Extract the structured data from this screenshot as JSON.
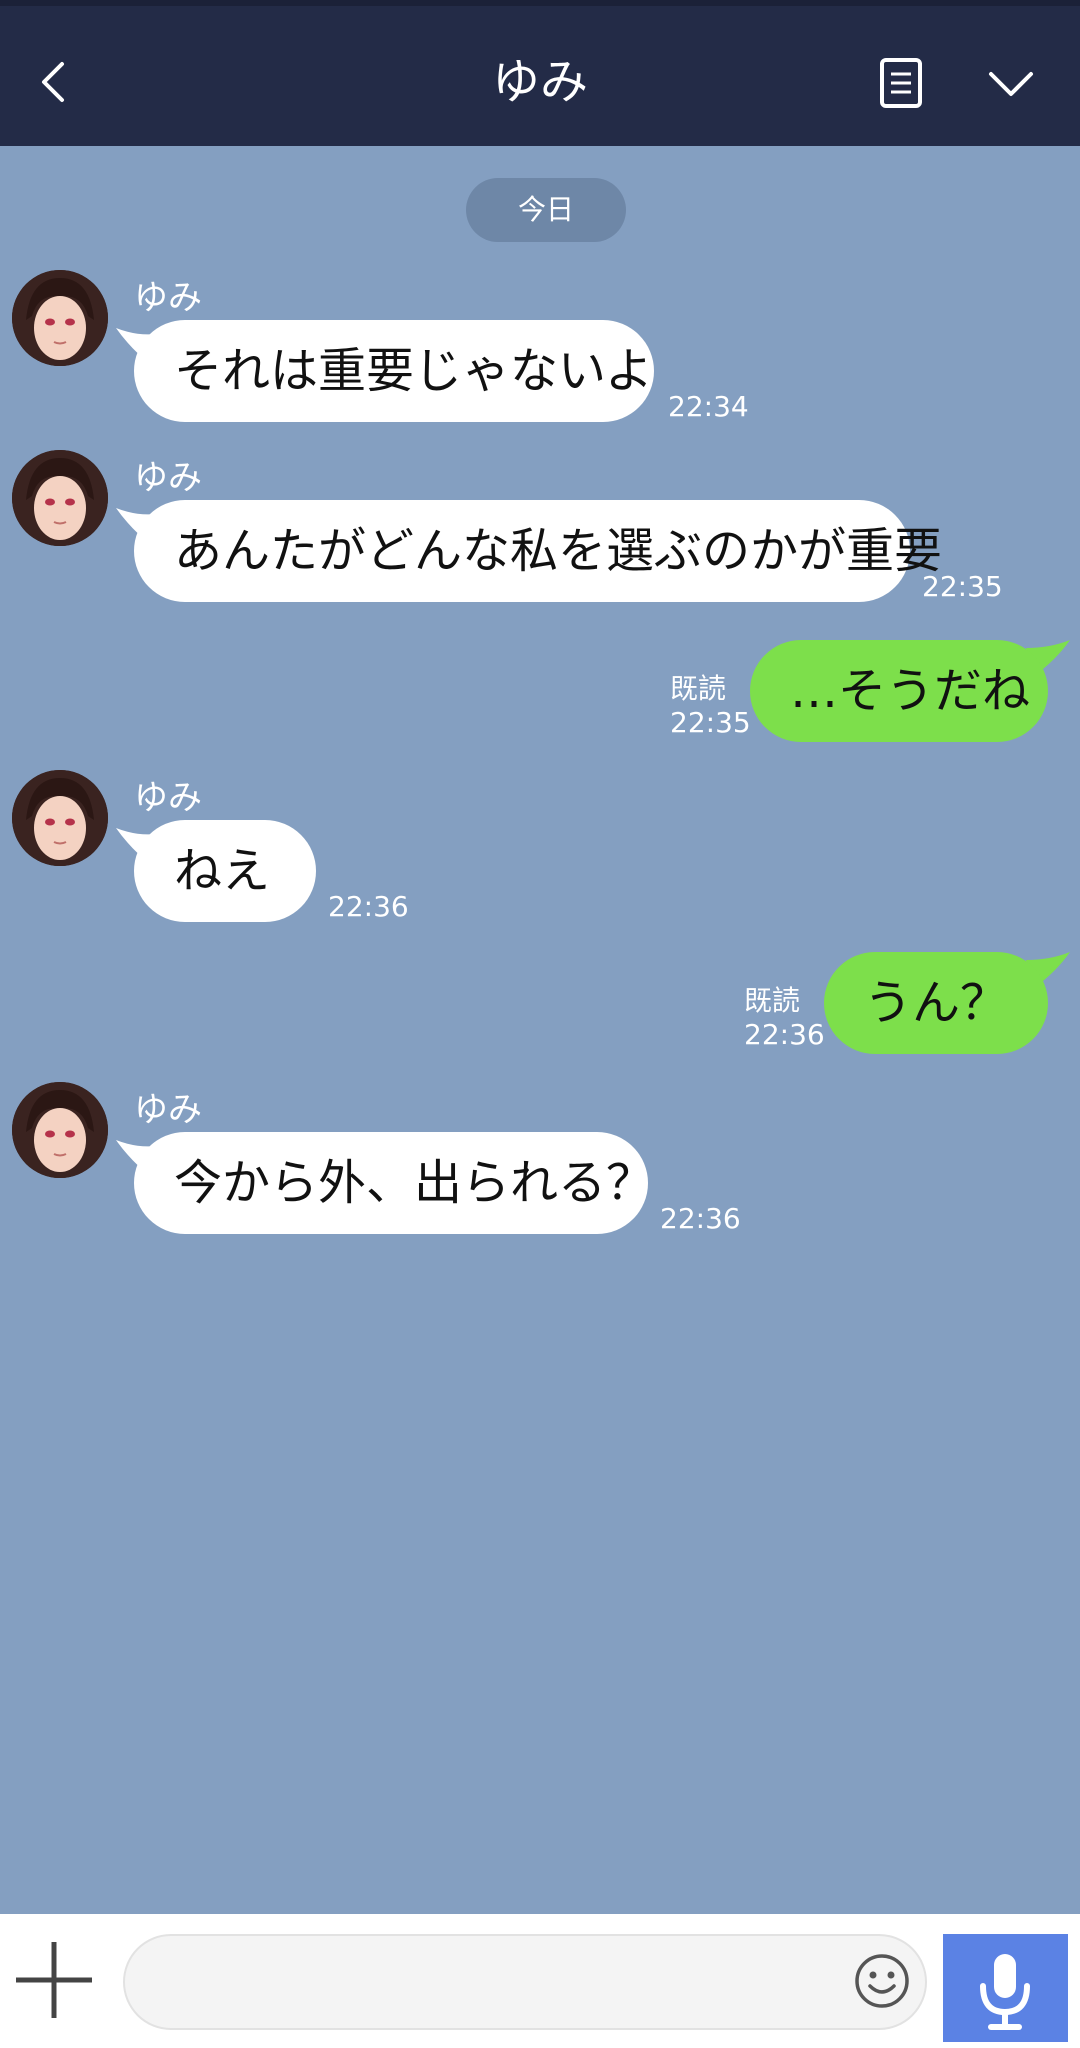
{
  "header": {
    "title": "ゆみ",
    "back_icon": "chevron-left-icon",
    "note_icon": "note-icon",
    "dropdown_icon": "chevron-down-icon"
  },
  "chat": {
    "date_label": "今日",
    "messages": [
      {
        "direction": "in",
        "sender": "ゆみ",
        "text": "それは重要じゃないよ",
        "time": "22:34"
      },
      {
        "direction": "in",
        "sender": "ゆみ",
        "text": "あんたがどんな私を選ぶのかが重要",
        "time": "22:35"
      },
      {
        "direction": "out",
        "text": "…そうだね",
        "read": "既読",
        "time": "22:35"
      },
      {
        "direction": "in",
        "sender": "ゆみ",
        "text": "ねえ",
        "time": "22:36"
      },
      {
        "direction": "out",
        "text": "うん？",
        "read": "既読",
        "time": "22:36"
      },
      {
        "direction": "in",
        "sender": "ゆみ",
        "text": "今から外、出られる？",
        "time": "22:36"
      }
    ]
  },
  "input_bar": {
    "plus_icon": "plus-icon",
    "message_value": "",
    "emoji_icon": "smiley-icon",
    "mic_icon": "microphone-icon"
  },
  "colors": {
    "header_bg": "#232b47",
    "chat_bg": "#849fc1",
    "bubble_in": "#ffffff",
    "bubble_out": "#7ddf4b",
    "mic_button": "#5b82e4"
  }
}
